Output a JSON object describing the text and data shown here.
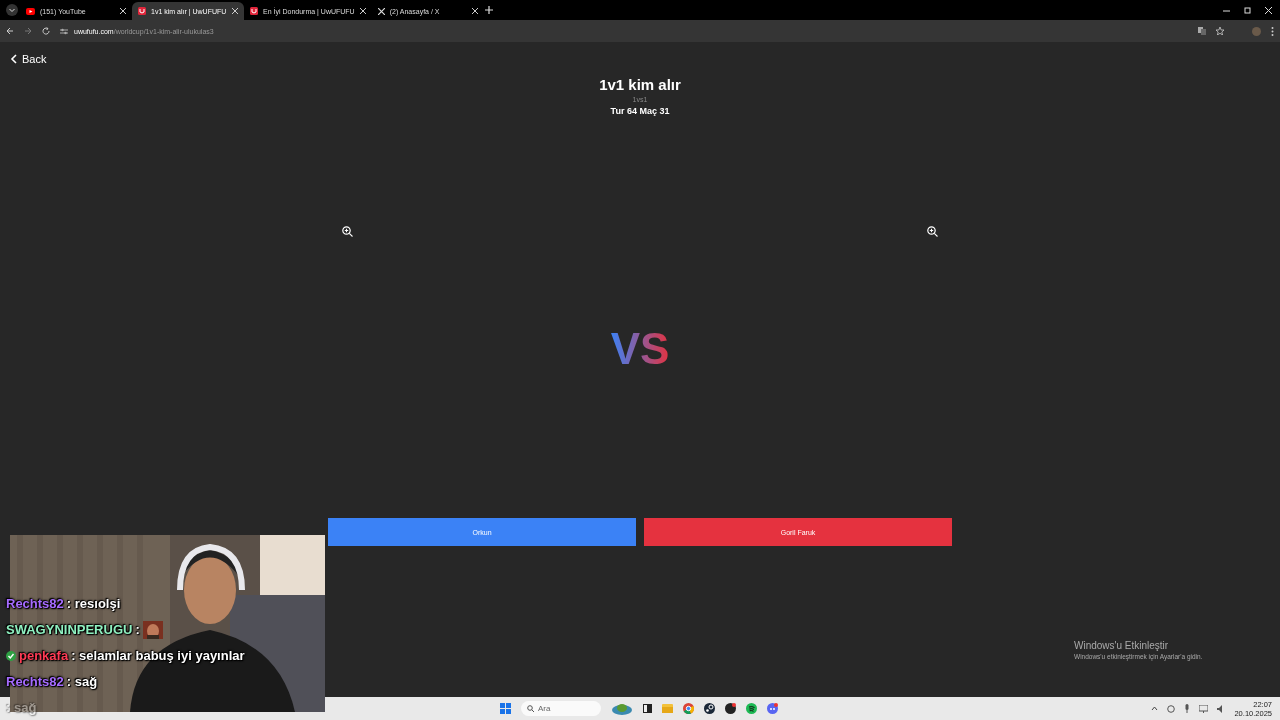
{
  "browser": {
    "tabs": [
      {
        "title": "(151) YouTube",
        "kind": "youtube",
        "selected": false
      },
      {
        "title": "1v1 kim alır | UwUFUFU",
        "kind": "uwufufu",
        "selected": true
      },
      {
        "title": "En İyi Dondurma | UwUFUFU",
        "kind": "uwufufu",
        "selected": false
      },
      {
        "title": "(2) Anasayfa / X",
        "kind": "x",
        "selected": false
      }
    ],
    "url_domain": "uwufufu.com",
    "url_path": "/worldcup/1v1-kim-alir-ulukulas3"
  },
  "page": {
    "back": "Back",
    "title": "1v1 kim alır",
    "subtitle": "1vs1",
    "round": "Tur 64 Maç 31",
    "vs": "VS",
    "choices": [
      {
        "label": "Orkun",
        "color": "#3b82f6"
      },
      {
        "label": "Goril Faruk",
        "color": "#e5323f"
      }
    ]
  },
  "stream": {
    "chat": [
      {
        "user": "Rechts82",
        "color": "#a66bff",
        "message": ": resıolşi",
        "badge": false,
        "emote": false
      },
      {
        "user": "SWAGYNINPERUGU",
        "color": "#8ff0c0",
        "message": " :",
        "badge": false,
        "emote": true
      },
      {
        "user": "penkafa",
        "color": "#ff3b55",
        "message": ": selamlar babuş iyi yayınlar",
        "badge": true,
        "emote": false
      },
      {
        "user": "Rechts82",
        "color": "#a66bff",
        "message": ": sağ",
        "badge": false,
        "emote": false
      },
      {
        "message": ": sağ",
        "faded": true
      }
    ]
  },
  "windows": {
    "watermark_title": "Windows'u Etkinleştir",
    "watermark_text": "Windows'u etkinleştirmek için Ayarlar'a gidin.",
    "search_placeholder": "Ara",
    "time": "22:07",
    "date": "20.10.2025"
  }
}
